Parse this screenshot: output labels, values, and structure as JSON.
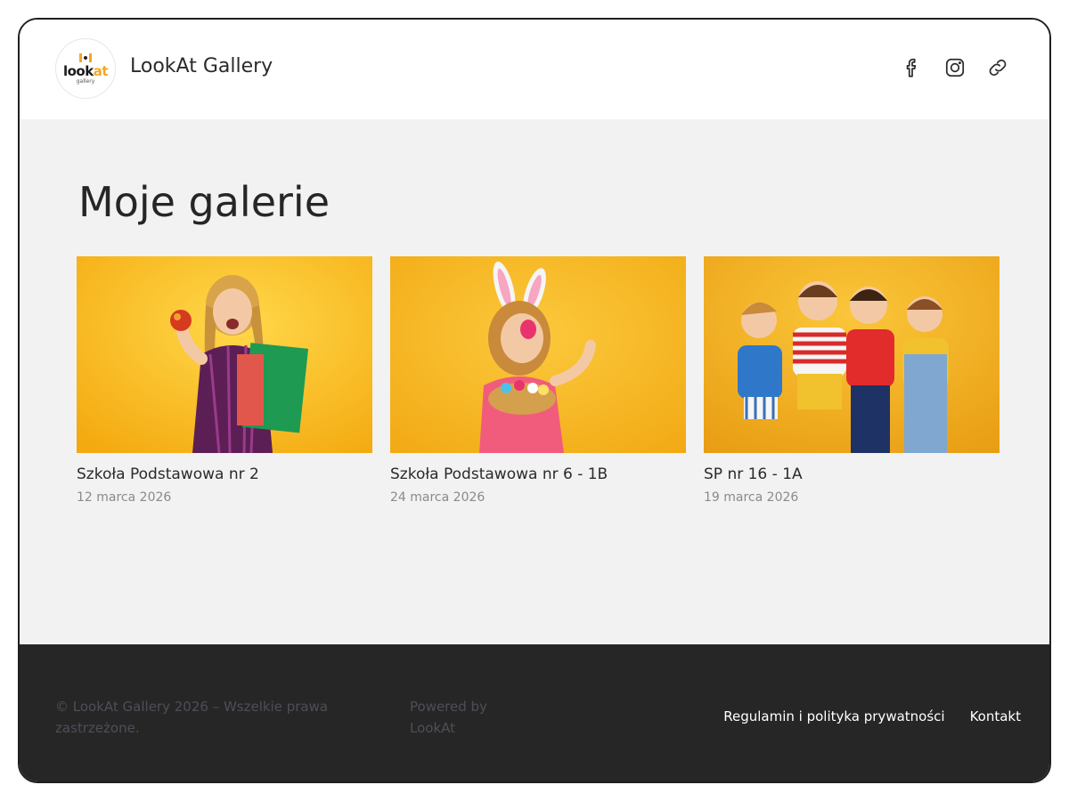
{
  "header": {
    "logo_word_main": "look",
    "logo_word_accent": "at",
    "logo_sub": "gallery",
    "site_title": "LookAt Gallery",
    "social_icons": [
      "facebook-icon",
      "instagram-icon",
      "link-icon"
    ]
  },
  "main": {
    "title": "Moje galerie",
    "galleries": [
      {
        "title": "Szkoła Podstawowa nr 2",
        "date": "12 marca 2026"
      },
      {
        "title": "Szkoła Podstawowa nr 6 - 1B",
        "date": "24 marca 2026"
      },
      {
        "title": "SP nr 16 - 1A",
        "date": "19 marca 2026"
      }
    ]
  },
  "footer": {
    "copyright": "© LookAt Gallery 2026 – Wszelkie prawa zastrzeżone.",
    "powered": "Powered by LookAt",
    "links": [
      "Regulamin i polityka prywatności",
      "Kontakt"
    ]
  },
  "colors": {
    "accent": "#f5a623",
    "photo_background": "#f7b91a",
    "footer_background": "#262626",
    "page_background": "#f2f2f2"
  }
}
